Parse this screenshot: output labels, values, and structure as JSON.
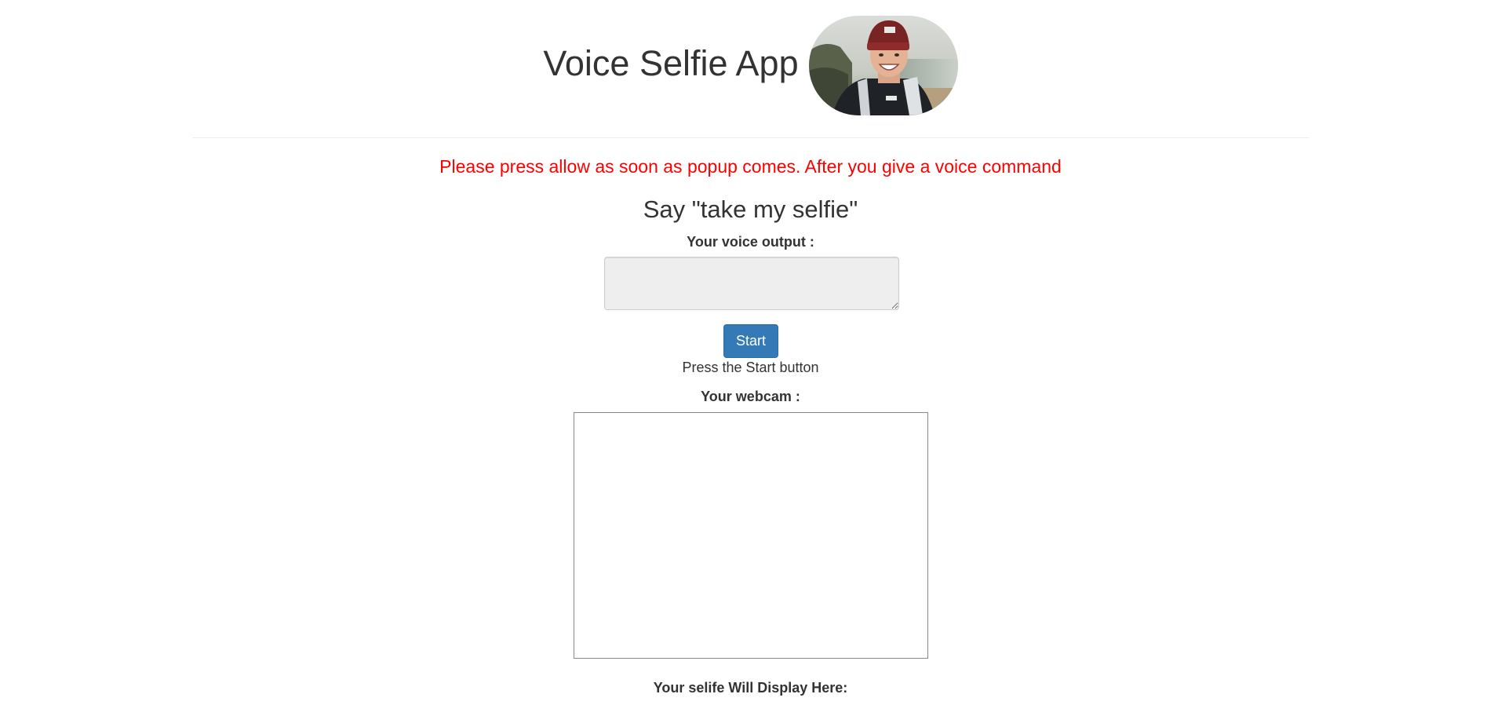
{
  "header": {
    "title": "Voice Selfie App",
    "avatar_icon": "selfie-photo"
  },
  "notice": {
    "text": "Please press allow as soon as popup comes. After you give a voice command",
    "color": "#ff0000"
  },
  "instruction": {
    "text": "Say \"take my selfie\""
  },
  "voice": {
    "label": "Your voice output :",
    "value": ""
  },
  "controls": {
    "start_label": "Start",
    "status": "Press the Start button",
    "accent_color": "#337ab7"
  },
  "webcam": {
    "label": "Your webcam :"
  },
  "selfie": {
    "label": "Your selife Will Display Here:"
  }
}
